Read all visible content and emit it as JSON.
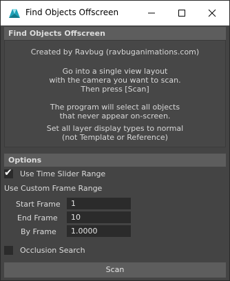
{
  "window": {
    "title": "Find Objects Offscreen",
    "controls": {
      "minimize": "—",
      "maximize": "☐",
      "close": "✕"
    }
  },
  "info": {
    "header": "Find Objects Offscreen",
    "credit": "Created by Ravbug (ravbuganimations.com)",
    "instructions": [
      "Go into a single view layout",
      "with the camera you want to scan.",
      "Then press [Scan]"
    ],
    "description": [
      "The program will select all objects",
      "that never appear on-screen."
    ],
    "note": [
      "Set all layer display types to normal",
      "(not Template or Reference)"
    ]
  },
  "options": {
    "header": "Options",
    "use_time_slider": {
      "label": "Use Time Slider Range",
      "checked": true
    },
    "custom_range_label": "Use Custom Frame Range",
    "start_frame": {
      "label": "Start Frame",
      "value": "1"
    },
    "end_frame": {
      "label": "End Frame",
      "value": "10"
    },
    "by_frame": {
      "label": "By Frame",
      "value": "1.0000"
    },
    "occlusion_search": {
      "label": "Occlusion Search",
      "checked": false
    }
  },
  "scan_button": {
    "label": "Scan"
  },
  "icons": {
    "app": "maya-app-icon"
  }
}
